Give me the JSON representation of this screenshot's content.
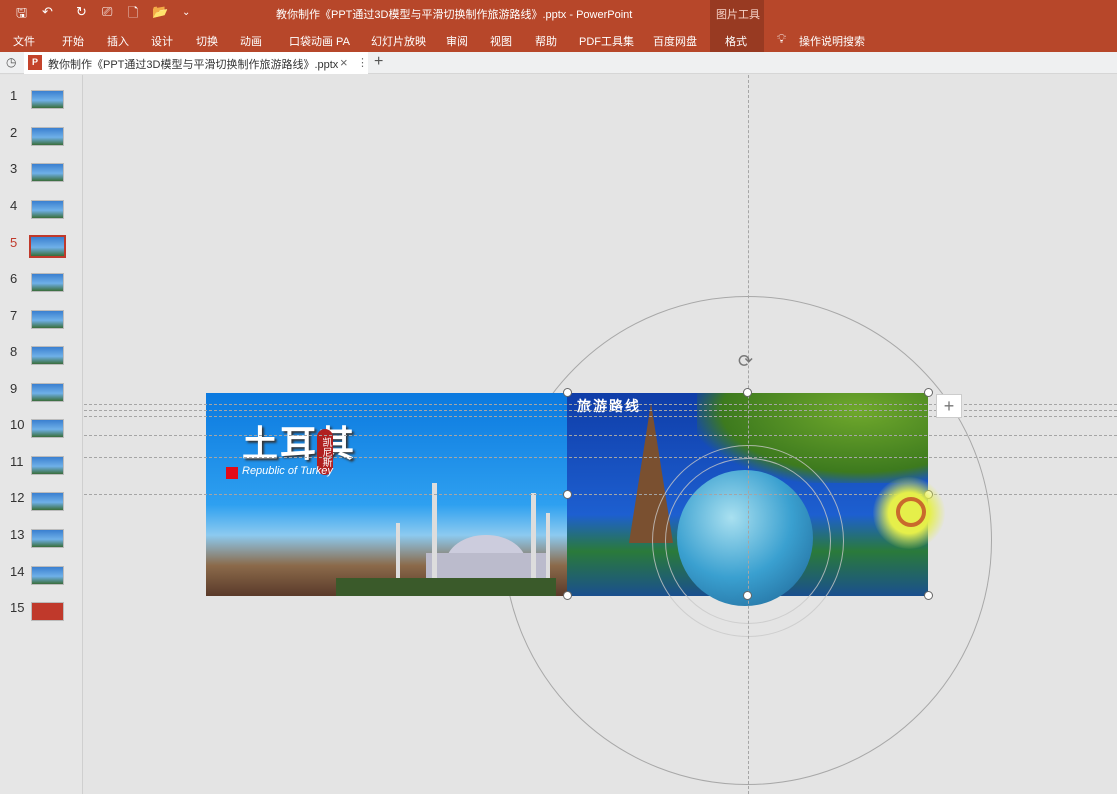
{
  "window": {
    "title": "教你制作《PPT通过3D模型与平滑切换制作旅游路线》.pptx  -  PowerPoint",
    "context_group": "图片工具"
  },
  "quick_access": {
    "save": "🖫",
    "undo": "↶",
    "redo": "↻",
    "present": "⎚",
    "new": "🗋",
    "open": "📂",
    "more": "⌄"
  },
  "ribbon": {
    "tabs": [
      "文件",
      "开始",
      "插入",
      "设计",
      "切换",
      "动画",
      "口袋动画 PA",
      "幻灯片放映",
      "审阅",
      "视图",
      "帮助",
      "PDF工具集",
      "百度网盘",
      "格式"
    ],
    "active": "格式",
    "search": "操作说明搜索"
  },
  "doc_tab": {
    "label": "教你制作《PPT通过3D模型与平滑切换制作旅游路线》.pptx",
    "app_icon": "P",
    "close": "×",
    "menu": "⋮",
    "add": "+"
  },
  "slides": {
    "numbers": [
      "1",
      "2",
      "3",
      "4",
      "5",
      "6",
      "7",
      "8",
      "9",
      "10",
      "11",
      "12",
      "13",
      "14",
      "15"
    ],
    "selected": "5"
  },
  "slide_content": {
    "turkey_title": "土耳其",
    "kenya_badge": "凯尼斯",
    "republic": "Republic of Turkey",
    "route_title": "旅游路线"
  },
  "canvas": {
    "add_button": "+",
    "rotate_icon": "⟳"
  }
}
